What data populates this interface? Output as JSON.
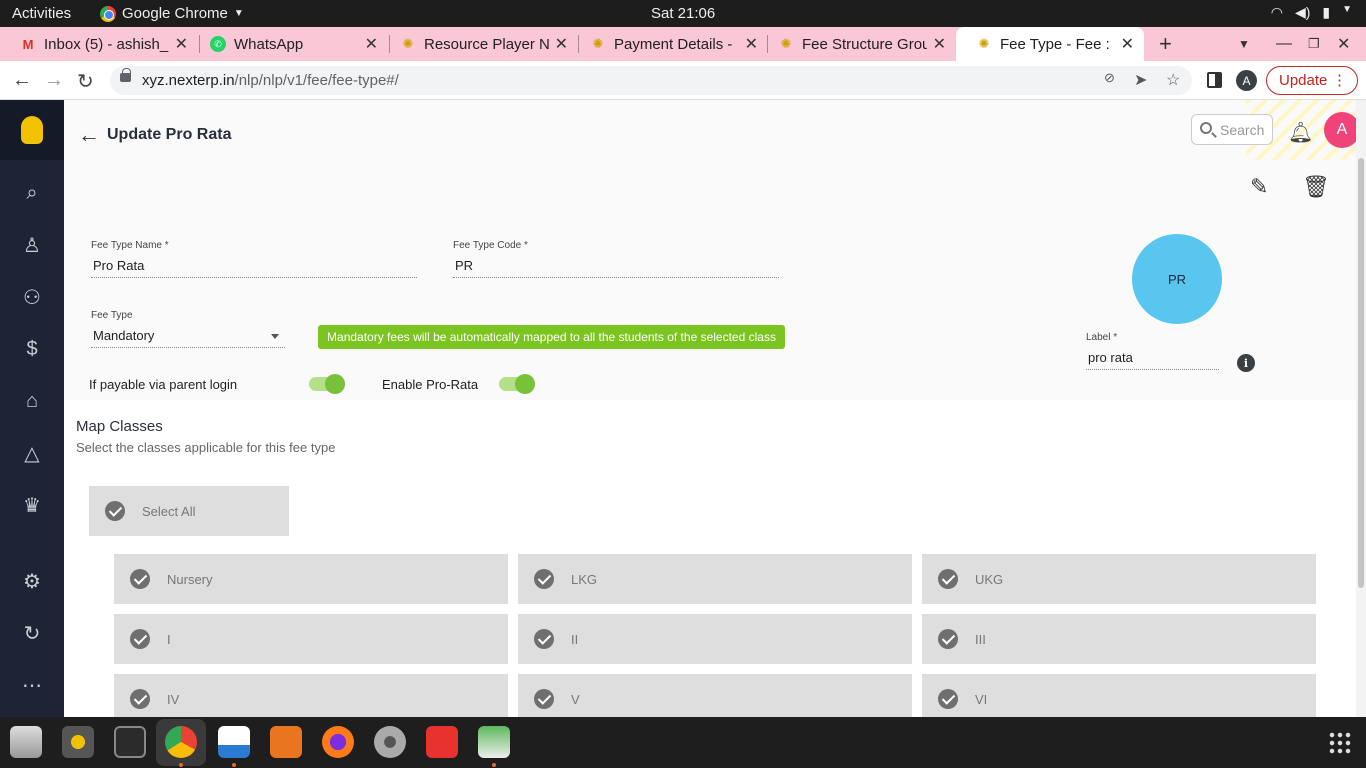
{
  "system": {
    "activities": "Activities",
    "app_name": "Google Chrome",
    "clock": "Sat 21:06"
  },
  "tabs": [
    {
      "title": "Inbox (5) - ashish_",
      "icon": "gmail-icon"
    },
    {
      "title": "WhatsApp",
      "icon": "whatsapp-icon"
    },
    {
      "title": "Resource Player N",
      "icon": "nlp-icon"
    },
    {
      "title": "Payment Details - ",
      "icon": "nlp-icon"
    },
    {
      "title": "Fee Structure Grou",
      "icon": "nlp-icon"
    },
    {
      "title": "Fee Type - Fee : NLP",
      "icon": "nlp-icon",
      "active": true
    }
  ],
  "address": {
    "host": "xyz.nexterp.in",
    "path": "/nlp/nlp/v1/fee/fee-type#/",
    "update_label": "Update",
    "profile_initial": "A"
  },
  "header": {
    "title": "Update Pro Rata",
    "search_placeholder": "Search",
    "avatar_initial": "A"
  },
  "form": {
    "fee_type_name_label": "Fee Type Name *",
    "fee_type_name_value": "Pro Rata",
    "fee_type_code_label": "Fee Type Code *",
    "fee_type_code_value": "PR",
    "fee_type_label": "Fee Type",
    "fee_type_value": "Mandatory",
    "notice": "Mandatory fees will be automatically mapped to all the students of the selected class",
    "circle_text": "PR",
    "label_label": "Label *",
    "label_value": "pro rata",
    "parent_login_label": "If payable via parent login",
    "parent_login_on": true,
    "pro_rata_label": "Enable Pro-Rata",
    "pro_rata_on": true
  },
  "map": {
    "title": "Map Classes",
    "subtitle": "Select the classes applicable for this fee type",
    "select_all": "Select All",
    "classes": [
      "Nursery",
      "LKG",
      "UKG",
      "I",
      "II",
      "III",
      "IV",
      "V",
      "VI"
    ]
  },
  "colors": {
    "sidebar": "#1e2435",
    "accent_green": "#7cc41f",
    "circle": "#58c6ef",
    "avatar": "#f0437a",
    "tabstrip": "#f9c7d6"
  }
}
